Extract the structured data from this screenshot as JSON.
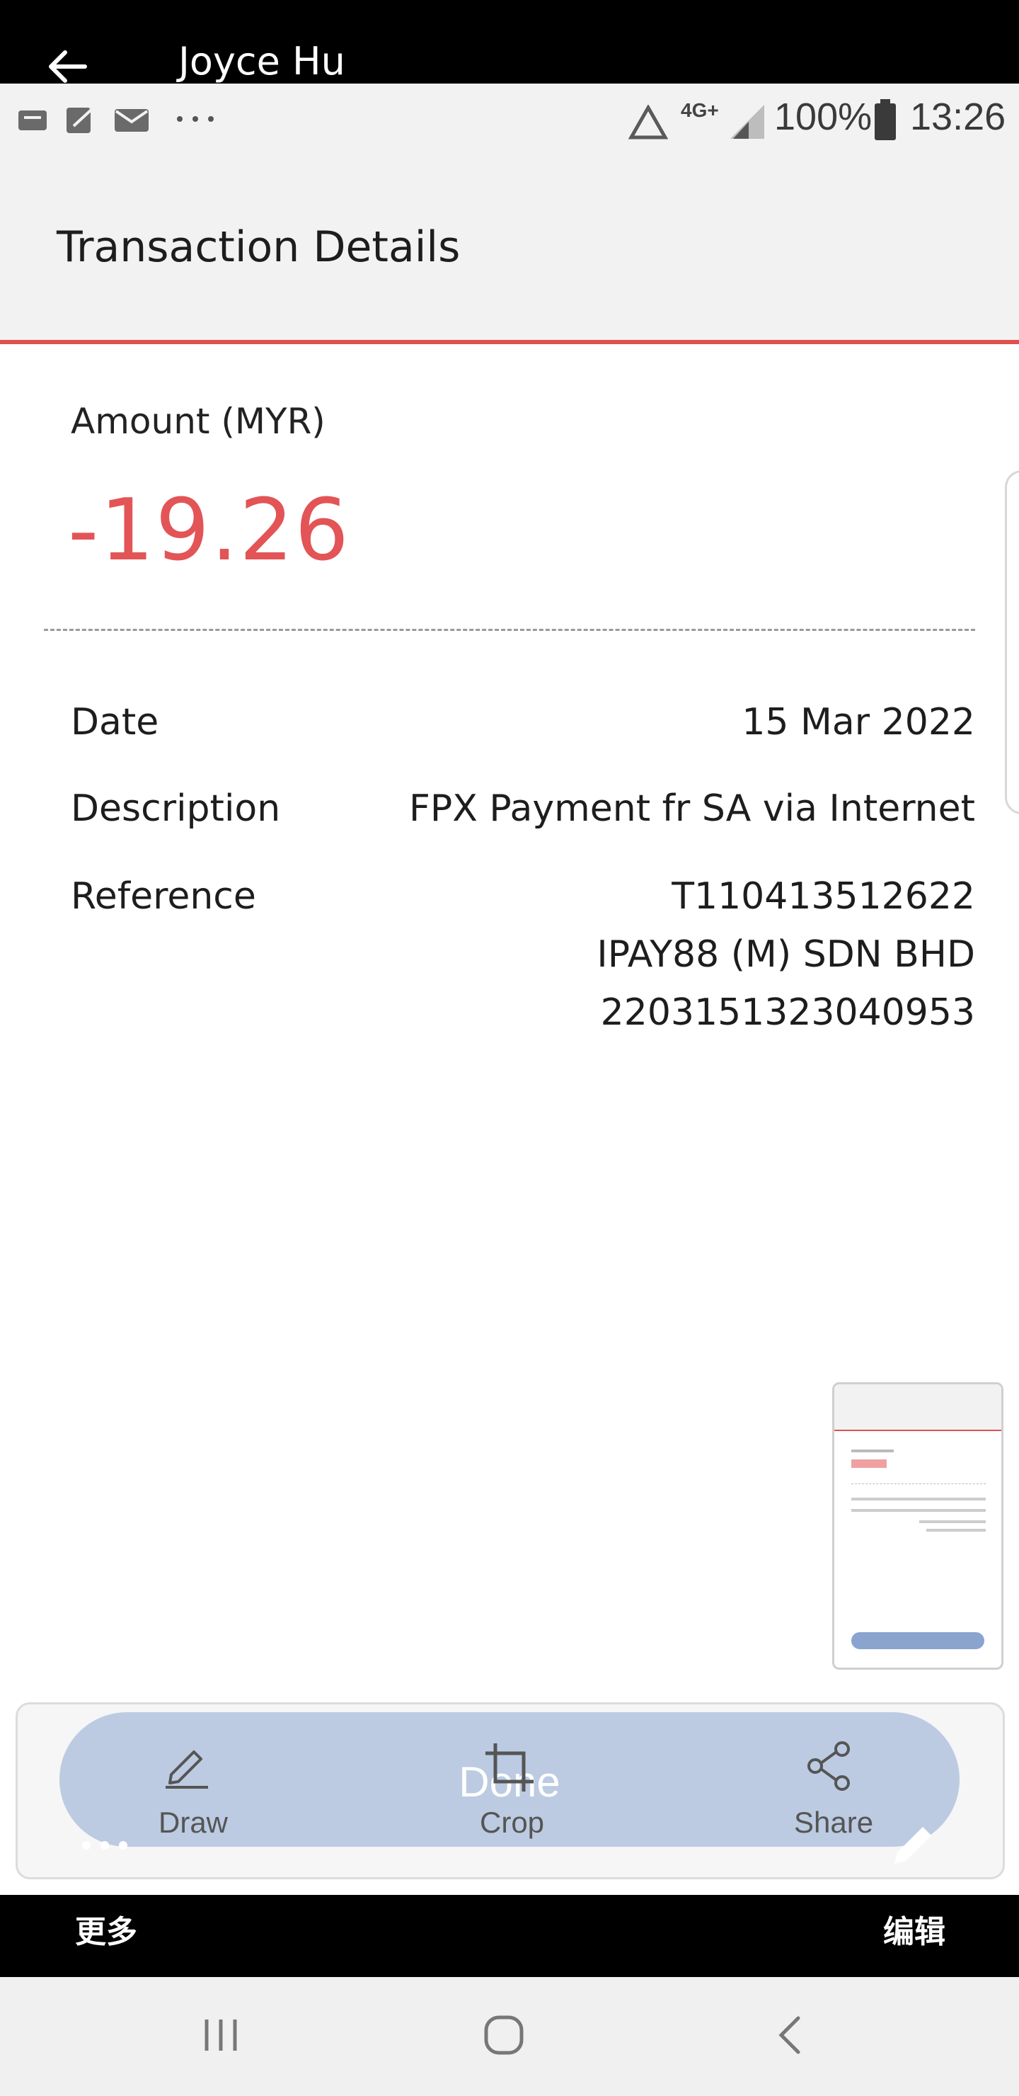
{
  "viewer": {
    "contact_name": "Joyce Hu",
    "more_label": "更多",
    "edit_label": "编辑"
  },
  "status_bar": {
    "network": "4G+",
    "battery": "100%",
    "time": "13:26"
  },
  "page": {
    "title": "Transaction Details"
  },
  "transaction": {
    "amount_label": "Amount (MYR)",
    "amount": "-19.26",
    "rows": [
      {
        "label": "Date",
        "value": "15 Mar 2022"
      },
      {
        "label": "Description",
        "value": "FPX Payment fr SA via Internet"
      },
      {
        "label": "Reference",
        "value_lines": [
          "T110413512622",
          "IPAY88 (M) SDN BHD",
          "2203151323040953"
        ]
      }
    ]
  },
  "toolbar": {
    "done_label": "Done",
    "draw_label": "Draw",
    "crop_label": "Crop",
    "share_label": "Share"
  },
  "colors": {
    "accent": "#e0504f",
    "amount": "#e35456",
    "done_button": "#bccbe2"
  },
  "icons": [
    "back-arrow-icon",
    "signal-icon",
    "battery-icon",
    "draw-icon",
    "crop-icon",
    "share-icon",
    "edit-pencil-icon",
    "more-dots-icon",
    "recent-apps-icon",
    "home-icon",
    "back-nav-icon"
  ]
}
